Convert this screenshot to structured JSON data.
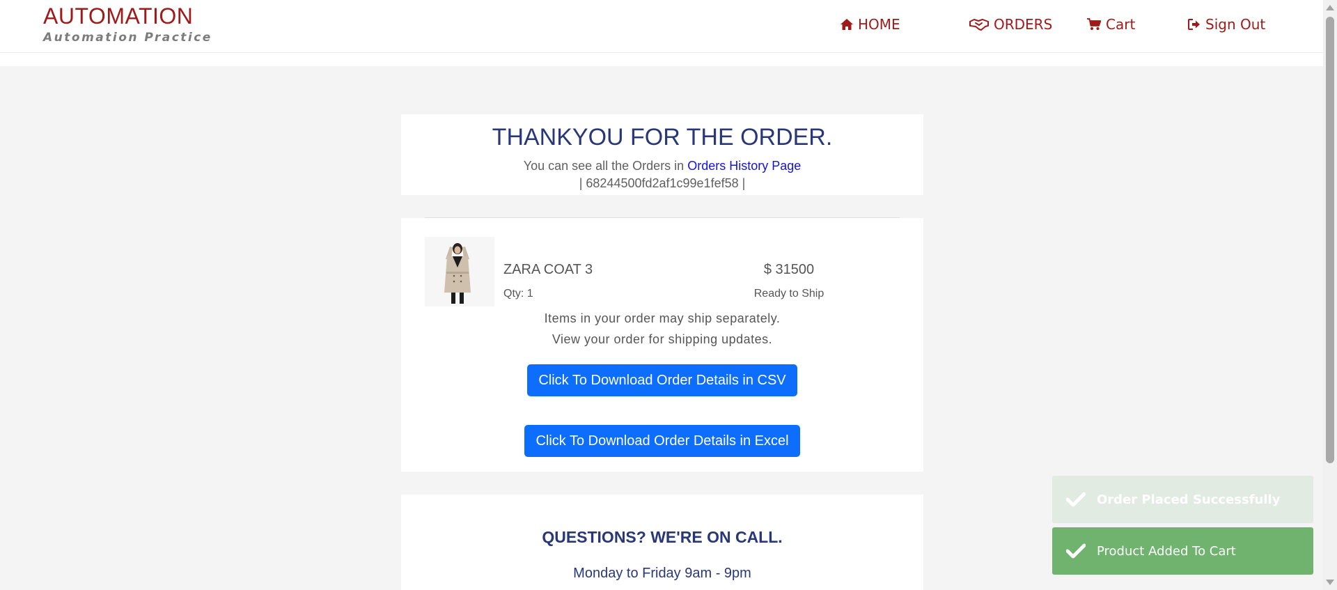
{
  "brand": {
    "title": "AUTOMATION",
    "subtitle": "Automation Practice",
    "color": "#a11a1a"
  },
  "nav": {
    "home": {
      "label": "HOME",
      "icon": "home-icon"
    },
    "orders": {
      "label": "ORDERS",
      "icon": "handshake-icon"
    },
    "cart": {
      "label": "Cart",
      "icon": "shopping-cart-icon"
    },
    "signout": {
      "label": "Sign Out",
      "icon": "sign-out-icon"
    }
  },
  "confirmation": {
    "title": "THANKYOU FOR THE ORDER.",
    "subtitle_prefix": "You can see all the Orders in",
    "history_link": "Orders History Page",
    "order_id": "| 68244500fd2af1c99e1fef58 |"
  },
  "order_item": {
    "name": "ZARA COAT 3",
    "price": "$ 31500",
    "qty": "Qty: 1",
    "status": "Ready to Ship",
    "ship_note_1": "Items in your order may ship separately.",
    "ship_note_2": "View your order for shipping updates."
  },
  "actions": {
    "download_csv": "Click To Download Order Details in CSV",
    "download_excel": "Click To Download Order Details in Excel"
  },
  "support": {
    "title": "QUESTIONS? WE'RE ON CALL.",
    "hours": "Monday to Friday 9am - 9pm"
  },
  "toasts": [
    {
      "message": "Order Placed Successfully",
      "icon": "check-icon"
    },
    {
      "message": "Product Added To Cart",
      "icon": "check-icon"
    }
  ],
  "colors": {
    "accent": "#a11a1a",
    "heading": "#283779",
    "button": "#0d6efd",
    "link": "#1414d9",
    "toast_success": "#6fb36f"
  }
}
